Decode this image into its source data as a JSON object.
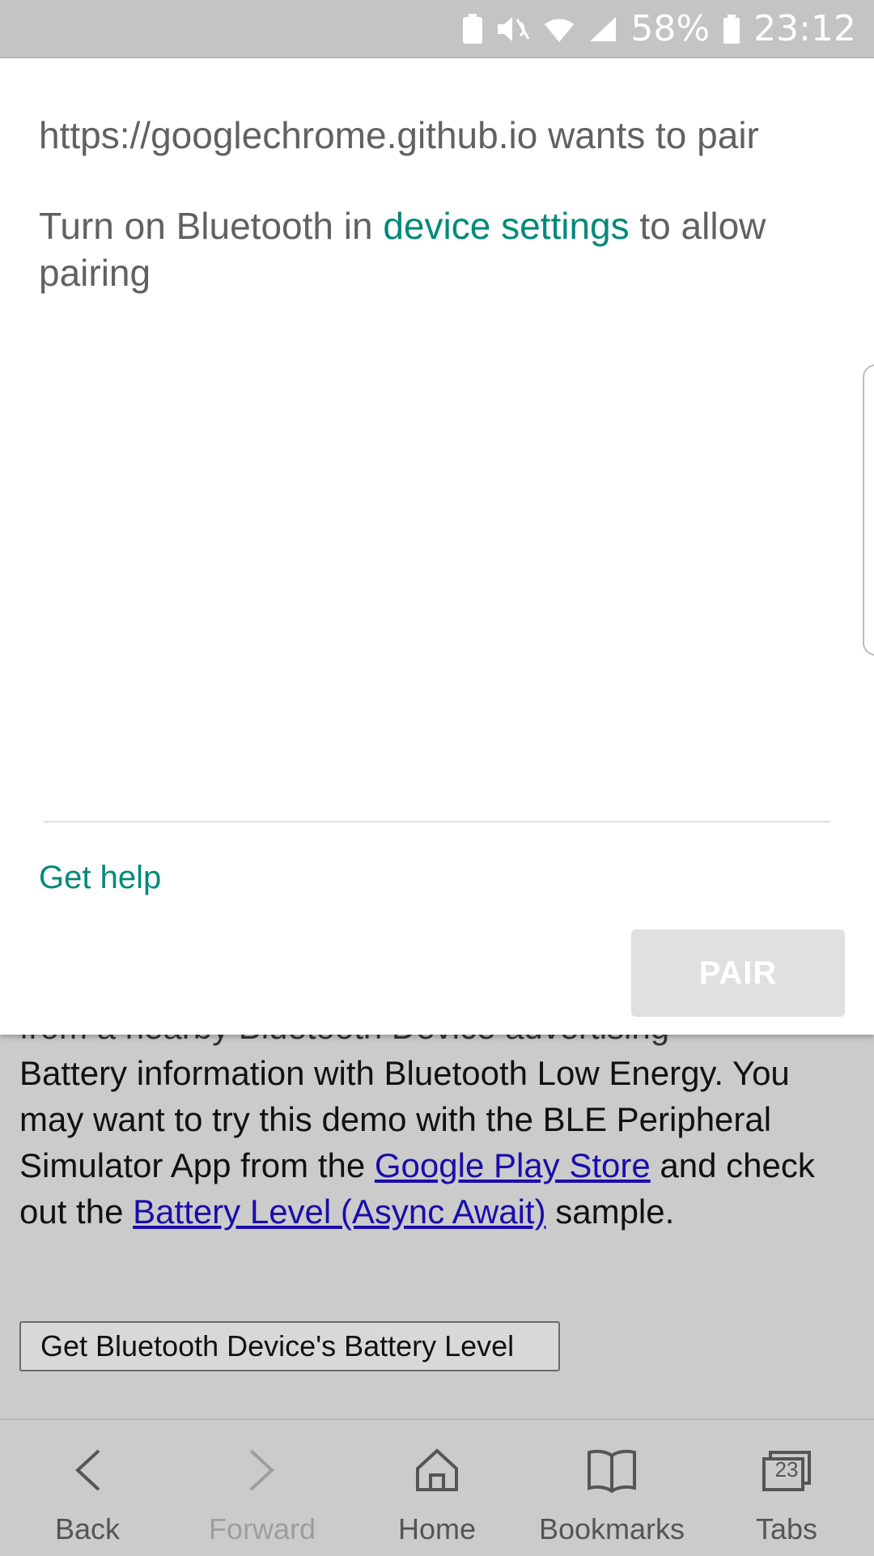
{
  "status_bar": {
    "battery_percent": "58%",
    "time": "23:12"
  },
  "dialog": {
    "title": "https://googlechrome.github.io wants to pair",
    "message_before": "Turn on Bluetooth in ",
    "message_link": "device settings",
    "message_after": " to allow pairing",
    "help_link": "Get help",
    "pair_button": "PAIR"
  },
  "page": {
    "cut_line": "from a nearby Bluetooth Device advertising",
    "line_part1": "Battery information with Bluetooth Low Energy. You may want to try this demo with the BLE Peripheral Simulator App from the ",
    "link_play_store": "Google Play Store",
    "line_part2": " and check out the ",
    "link_battery_sample": "Battery Level (Async Await)",
    "line_part3": " sample.",
    "battery_button": "Get Bluetooth Device's Battery Level"
  },
  "bottom_nav": {
    "back": "Back",
    "forward": "Forward",
    "home": "Home",
    "bookmarks": "Bookmarks",
    "tabs": "Tabs",
    "tab_count": "23"
  }
}
